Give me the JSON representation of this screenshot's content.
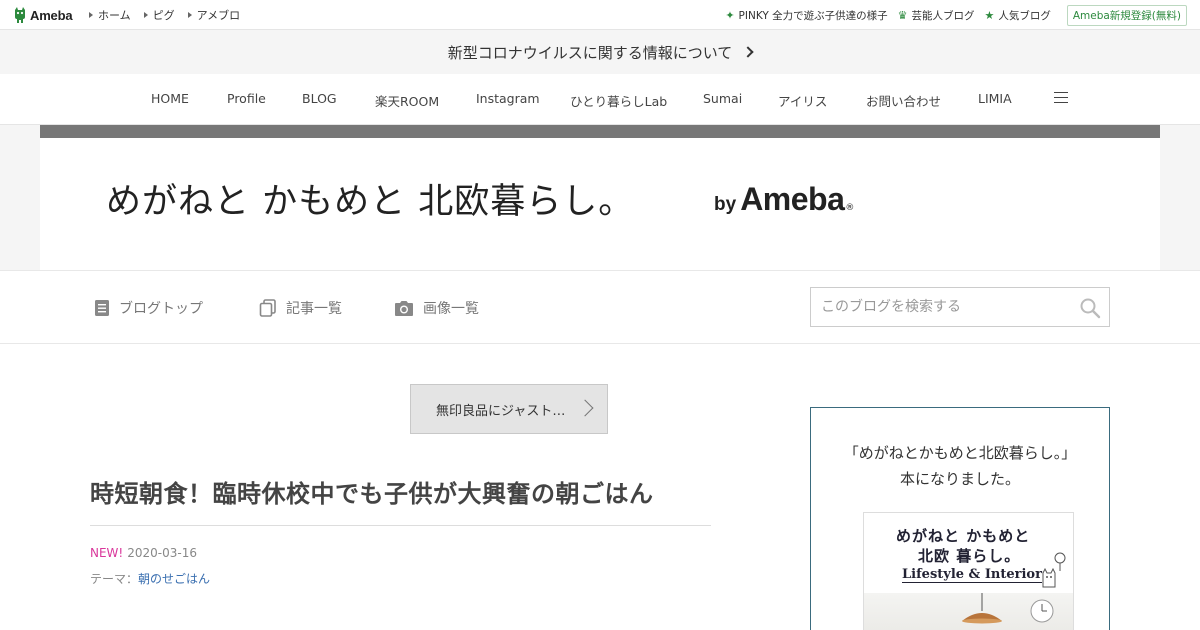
{
  "topbar": {
    "logo_text": "Ameba",
    "nav": [
      "ホーム",
      "ピグ",
      "アメブロ"
    ],
    "right_links": [
      {
        "icon": "sparkle-icon",
        "label": "PINKY 全力で遊ぶ子供達の様子"
      },
      {
        "icon": "crown-icon",
        "label": "芸能人ブログ"
      },
      {
        "icon": "star-icon",
        "label": "人気ブログ"
      }
    ],
    "register_label": "Ameba新規登録(無料)"
  },
  "notice": {
    "text": "新型コロナウイルスに関する情報について"
  },
  "menu": {
    "items": [
      "HOME",
      "Profile",
      "BLOG",
      "楽天ROOM",
      "Instagram",
      "ひとり暮らしLab",
      "Sumai",
      "アイリス",
      "お問い合わせ",
      "LIMIA"
    ]
  },
  "header": {
    "blog_title": "めがねと かもめと 北欧暮らし。",
    "by": "by",
    "brand": "Ameba",
    "reg_mark": "®"
  },
  "blog_nav": {
    "top_label": "ブログトップ",
    "entries_label": "記事一覧",
    "images_label": "画像一覧",
    "search_placeholder": "このブログを検索する"
  },
  "article": {
    "prev_link": "無印良品にジャスト…",
    "title": "時短朝食！臨時休校中でも子供が大興奮の朝ごはん",
    "new_badge": "NEW!",
    "date": "2020-03-16",
    "theme_label": "テーマ：",
    "theme_value": "朝のせごはん"
  },
  "sidebar": {
    "line1": "「めがねとかもめと北欧暮らし。」",
    "line2": "本になりました。",
    "book_line1": "めがねと かもめと",
    "book_line2": "北欧 暮らし。",
    "book_line3": "Lifestyle & Interior"
  },
  "colors": {
    "ameba_green": "#2d8a3e",
    "new_pink": "#d9379b",
    "link_blue": "#3a6fb0",
    "banner_bar": "#777777"
  }
}
